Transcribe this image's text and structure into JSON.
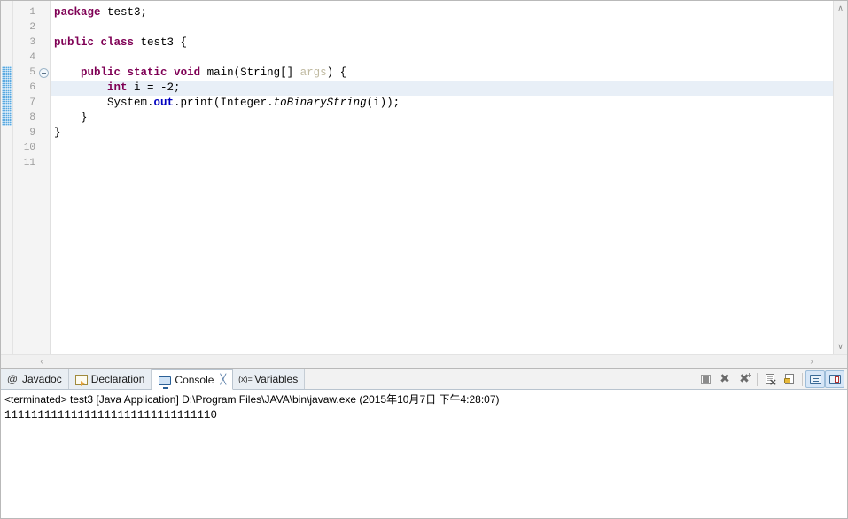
{
  "editor": {
    "line_numbers": [
      "1",
      "2",
      "3",
      "4",
      "5",
      "6",
      "7",
      "8",
      "9",
      "10",
      "11"
    ],
    "current_line": 6,
    "fold_marker_line": 5,
    "annotation_range": [
      5,
      8
    ],
    "colors": {
      "keyword": "#7f0055",
      "static_field": "#0000c0",
      "parameter": "#bfb9a0",
      "current_line_highlight": "#e8eff7",
      "annotation_blue": "#5aa9e0",
      "gutter_bg": "#f4f4f4",
      "line_number": "#9a9a9a"
    },
    "code": [
      {
        "n": "1",
        "tokens": [
          {
            "t": "package",
            "c": "kw"
          },
          {
            "t": " test3;",
            "c": "plain"
          }
        ]
      },
      {
        "n": "2",
        "tokens": []
      },
      {
        "n": "3",
        "tokens": [
          {
            "t": "public",
            "c": "kw"
          },
          {
            "t": " ",
            "c": "plain"
          },
          {
            "t": "class",
            "c": "kw"
          },
          {
            "t": " test3 {",
            "c": "plain"
          }
        ]
      },
      {
        "n": "4",
        "tokens": []
      },
      {
        "n": "5",
        "tokens": [
          {
            "t": "    ",
            "c": "plain"
          },
          {
            "t": "public",
            "c": "kw"
          },
          {
            "t": " ",
            "c": "plain"
          },
          {
            "t": "static",
            "c": "kw"
          },
          {
            "t": " ",
            "c": "plain"
          },
          {
            "t": "void",
            "c": "kw"
          },
          {
            "t": " main(String[] ",
            "c": "plain"
          },
          {
            "t": "args",
            "c": "param"
          },
          {
            "t": ") {",
            "c": "plain"
          }
        ]
      },
      {
        "n": "6",
        "tokens": [
          {
            "t": "        ",
            "c": "plain"
          },
          {
            "t": "int",
            "c": "kw"
          },
          {
            "t": " i = -2;",
            "c": "plain"
          }
        ]
      },
      {
        "n": "7",
        "tokens": [
          {
            "t": "        System.",
            "c": "plain"
          },
          {
            "t": "out",
            "c": "sfield"
          },
          {
            "t": ".print(Integer.",
            "c": "plain"
          },
          {
            "t": "toBinaryString",
            "c": "smeth"
          },
          {
            "t": "(i));",
            "c": "plain"
          }
        ]
      },
      {
        "n": "8",
        "tokens": [
          {
            "t": "    }",
            "c": "plain"
          }
        ]
      },
      {
        "n": "9",
        "tokens": [
          {
            "t": "}",
            "c": "plain"
          }
        ]
      },
      {
        "n": "10",
        "tokens": []
      },
      {
        "n": "11",
        "tokens": []
      }
    ],
    "vscrollbar": {
      "up_arrow": "∧",
      "down_arrow": "∨"
    },
    "hscrollbar": {
      "left_arrow": "‹",
      "right_arrow": "›"
    }
  },
  "bottom_panel": {
    "tabs": [
      {
        "label": "Javadoc",
        "icon": "javadoc-icon",
        "active": false,
        "closable": false
      },
      {
        "label": "Declaration",
        "icon": "declaration-icon",
        "active": false,
        "closable": false
      },
      {
        "label": "Console",
        "icon": "console-icon",
        "active": true,
        "closable": true
      },
      {
        "label": "Variables",
        "icon": "variables-icon",
        "active": false,
        "closable": false
      }
    ],
    "tab_close_glyph": "╳",
    "toolbar": [
      {
        "name": "terminate-button",
        "icon": "terminate-icon",
        "toggled": false
      },
      {
        "name": "remove-launch-button",
        "icon": "remove-icon",
        "toggled": false
      },
      {
        "name": "remove-all-terminated-button",
        "icon": "remove-all-icon",
        "toggled": false
      },
      {
        "name": "clear-console-button",
        "icon": "clear-console-icon",
        "toggled": false
      },
      {
        "name": "scroll-lock-button",
        "icon": "scroll-lock-icon",
        "toggled": false
      },
      {
        "name": "pin-console-button",
        "icon": "pin-console-icon",
        "toggled": true
      },
      {
        "name": "display-selected-console-button",
        "icon": "display-console-icon",
        "toggled": true
      }
    ],
    "console": {
      "status_line": "<terminated> test3 [Java Application] D:\\Program Files\\JAVA\\bin\\javaw.exe (2015年10月7日 下午4:28:07)",
      "output": "11111111111111111111111111111110"
    }
  }
}
